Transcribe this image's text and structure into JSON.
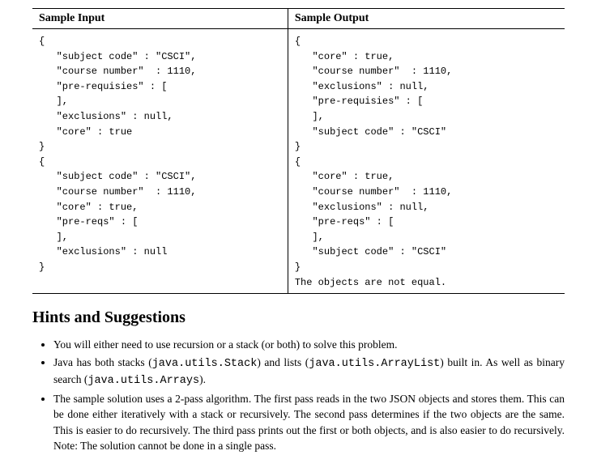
{
  "table": {
    "header_input": "Sample Input",
    "header_output": "Sample Output",
    "input_code": "{\n   \"subject code\" : \"CSCI\",\n   \"course number\"  : 1110,\n   \"pre-requisies\" : [\n   ],\n   \"exclusions\" : null,\n   \"core\" : true\n}\n{\n   \"subject code\" : \"CSCI\",\n   \"course number\"  : 1110,\n   \"core\" : true,\n   \"pre-reqs\" : [\n   ],\n   \"exclusions\" : null\n}",
    "output_code": "{\n   \"core\" : true,\n   \"course number\"  : 1110,\n   \"exclusions\" : null,\n   \"pre-requisies\" : [\n   ],\n   \"subject code\" : \"CSCI\"\n}\n{\n   \"core\" : true,\n   \"course number\"  : 1110,\n   \"exclusions\" : null,\n   \"pre-reqs\" : [\n   ],\n   \"subject code\" : \"CSCI\"\n}\nThe objects are not equal."
  },
  "hints": {
    "heading": "Hints and Suggestions",
    "items": {
      "b1": "You will either need to use recursion or a stack (or both) to solve this problem.",
      "b2a": "Java has both stacks (",
      "b2code1": "java.utils.Stack",
      "b2b": ") and lists (",
      "b2code2": "java.utils.ArrayList",
      "b2c": ") built in. As well as binary search (",
      "b2code3": "java.utils.Arrays",
      "b2d": ").",
      "b3": "The sample solution uses a 2-pass algorithm. The first pass reads in the two JSON objects and stores them. This can be done either iteratively with a stack or recursively. The second pass determines if the two objects are the same. This is easier to do recursively. The third pass prints out the first or both objects, and is also easier to do recursively. Note: The solution cannot be done in a single pass."
    }
  }
}
